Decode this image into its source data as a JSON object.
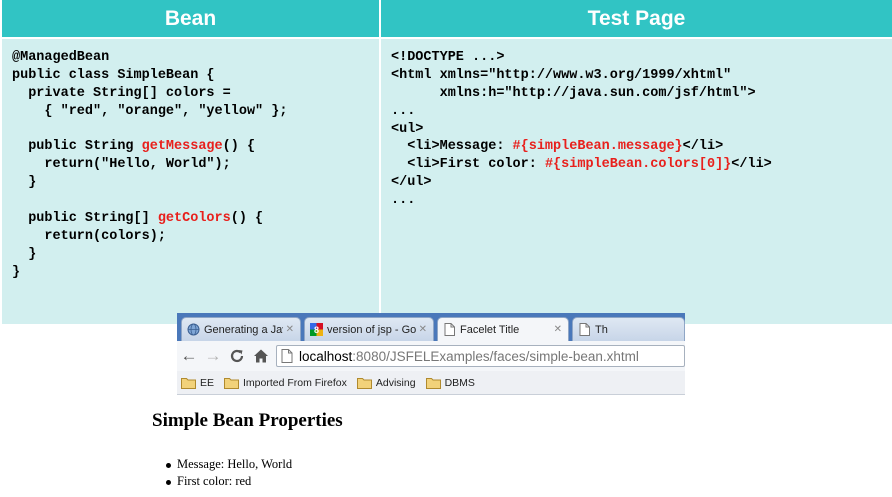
{
  "bean_header": "Bean",
  "test_header": "Test Page",
  "bean_code": [
    [
      {
        "t": "@ManagedBean"
      }
    ],
    [
      {
        "t": "public class SimpleBean {"
      }
    ],
    [
      {
        "t": "  private String[] colors ="
      }
    ],
    [
      {
        "t": "    { \"red\", \"orange\", \"yellow\" };"
      }
    ],
    [
      {
        "t": ""
      }
    ],
    [
      {
        "t": "  public String "
      },
      {
        "t": "getMessage",
        "c": "red"
      },
      {
        "t": "() {"
      }
    ],
    [
      {
        "t": "    return(\"Hello, World\");"
      }
    ],
    [
      {
        "t": "  }"
      }
    ],
    [
      {
        "t": ""
      }
    ],
    [
      {
        "t": "  public String[] "
      },
      {
        "t": "getColors",
        "c": "red"
      },
      {
        "t": "() {"
      }
    ],
    [
      {
        "t": "    return(colors);"
      }
    ],
    [
      {
        "t": "  }"
      }
    ],
    [
      {
        "t": "}"
      }
    ]
  ],
  "test_code": [
    [
      {
        "t": "<!DOCTYPE ...>"
      }
    ],
    [
      {
        "t": "<html xmlns=\"http://www.w3.org/1999/xhtml\""
      }
    ],
    [
      {
        "t": "      xmlns:h=\"http://java.sun.com/jsf/html\">"
      }
    ],
    [
      {
        "t": "..."
      }
    ],
    [
      {
        "t": "<ul>"
      }
    ],
    [
      {
        "t": "  <li>Message: "
      },
      {
        "t": "#{simpleBean.message}",
        "c": "red"
      },
      {
        "t": "</li>"
      }
    ],
    [
      {
        "t": "  <li>First color: "
      },
      {
        "t": "#{simpleBean.colors[0]}",
        "c": "red"
      },
      {
        "t": "</li>"
      }
    ],
    [
      {
        "t": "</ul>"
      }
    ],
    [
      {
        "t": "..."
      }
    ]
  ],
  "browser": {
    "tabs": [
      {
        "title": "Generating a JavaSer",
        "icon": "sphere-icon"
      },
      {
        "title": "version of jsp - Google",
        "icon": "google-icon"
      },
      {
        "title": "Facelet Title",
        "icon": "page-icon"
      },
      {
        "title": "Th",
        "icon": "page-icon"
      }
    ],
    "url_host": "localhost",
    "url_rest": ":8080/JSFELExamples/faces/simple-bean.xhtml",
    "bookmarks": [
      "EE",
      "Imported From Firefox",
      "Advising",
      "DBMS"
    ],
    "page_heading": "Simple Bean Properties",
    "page_items": [
      "Message: Hello, World",
      "First color: red"
    ]
  }
}
